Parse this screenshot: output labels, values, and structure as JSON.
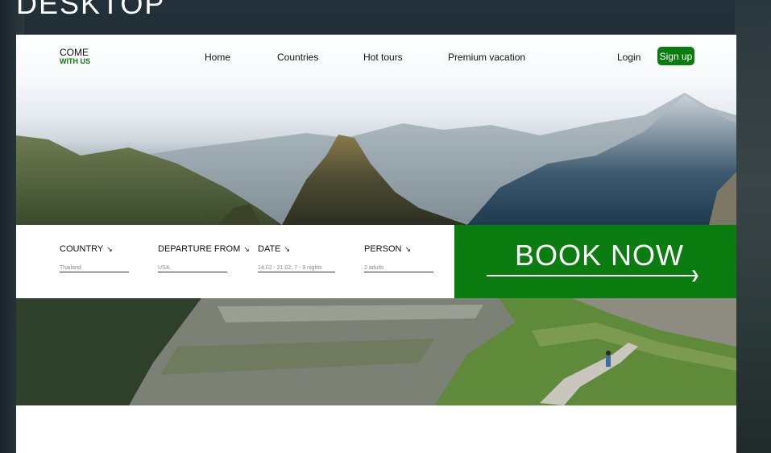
{
  "section_title": "DESKTOP",
  "logo": {
    "line1": "COME",
    "line2": "WITH US"
  },
  "nav": {
    "items": [
      "Home",
      "Countries",
      "Hot tours",
      "Premium vacation"
    ]
  },
  "auth": {
    "login": "Login",
    "signup": "Sign up"
  },
  "booking": {
    "fields": [
      {
        "label": "COUNTRY",
        "value": "Thailand"
      },
      {
        "label": "DEPARTURE FROM",
        "value": "USA"
      },
      {
        "label": "DATE",
        "value": "14.02 - 21.02, 7 - 9 nights"
      },
      {
        "label": "PERSON",
        "value": "2 adults"
      }
    ],
    "arrow_glyph": "↘",
    "cta": "BOOK NOW"
  },
  "colors": {
    "brand_green": "#0b7d10",
    "page_bg": "#1e2b33"
  }
}
